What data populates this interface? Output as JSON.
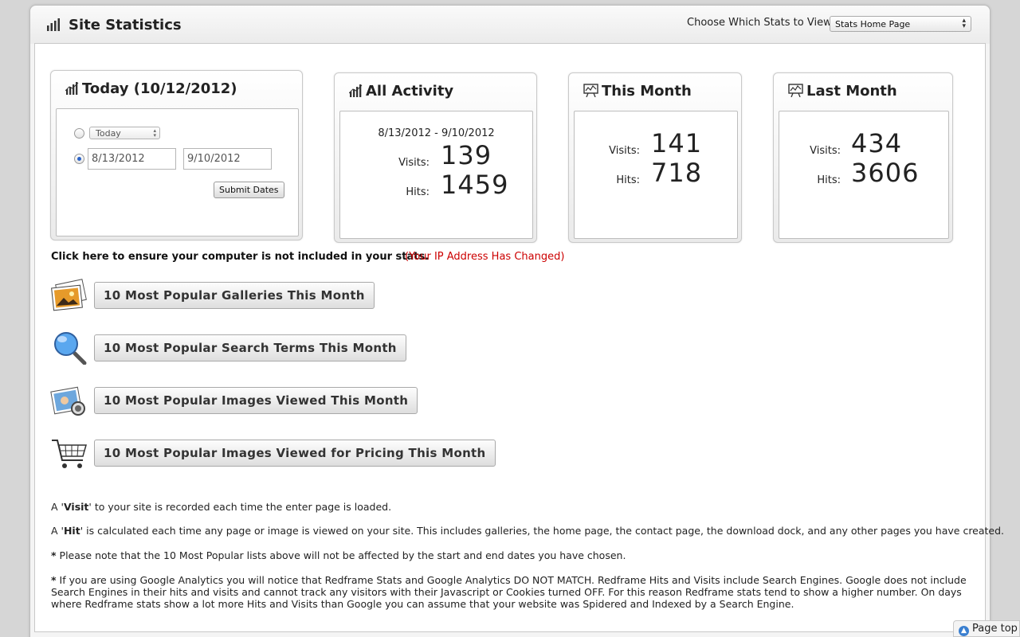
{
  "header": {
    "title": "Site Statistics",
    "chooser_label": "Choose Which Stats to View:",
    "chooser_value": "Stats Home Page"
  },
  "today_box": {
    "title": "Today (10/12/2012)",
    "range_select": "Today",
    "start_date": "8/13/2012",
    "end_date": "9/10/2012",
    "submit_label": "Submit Dates"
  },
  "all_activity": {
    "title": "All Activity",
    "range": "8/13/2012 - 9/10/2012",
    "visits_label": "Visits:",
    "visits": "139",
    "hits_label": "Hits:",
    "hits": "1459"
  },
  "this_month": {
    "title": "This Month",
    "visits_label": "Visits:",
    "visits": "141",
    "hits_label": "Hits:",
    "hits": "718"
  },
  "last_month": {
    "title": "Last Month",
    "visits_label": "Visits:",
    "visits": "434",
    "hits_label": "Hits:",
    "hits": "3606"
  },
  "notice": {
    "link": "Click here to ensure your computer is not included in your stats.",
    "warning": "(Your IP Address Has Changed)"
  },
  "reports": [
    {
      "label": "10 Most Popular Galleries This Month",
      "icon": "photos-icon"
    },
    {
      "label": "10 Most Popular Search Terms This Month",
      "icon": "magnifier-icon"
    },
    {
      "label": "10 Most Popular Images Viewed This Month",
      "icon": "image-viewer-icon"
    },
    {
      "label": "10 Most Popular Images Viewed for Pricing This Month",
      "icon": "shopping-cart-icon"
    }
  ],
  "notes": {
    "visit_pre": "A '",
    "visit_term": "Visit",
    "visit_post": "' to your site is recorded each time the enter page is loaded.",
    "hit_pre": "A '",
    "hit_term": "Hit",
    "hit_post": "' is calculated each time any page or image is viewed on your site. This includes galleries, the home page, the contact page, the download dock, and any other pages you have created.",
    "star": "*",
    "note_dates": "Please note that the 10 Most Popular lists above will not be affected by the start and end dates you have chosen.",
    "note_google": "If you are using Google Analytics you will notice that Redframe Stats and Google Analytics DO NOT MATCH. Redframe Hits and Visits include Search Engines. Google does not include Search Engines in their hits and visits and cannot track any visitors with their Javascript or Cookies turned OFF. For this reason Redframe stats tend to show a higher number. On days where Redframe stats show a lot more Hits and Visits than Google you can assume that your website was Spidered and Indexed by a Search Engine."
  },
  "page_top": "Page top"
}
